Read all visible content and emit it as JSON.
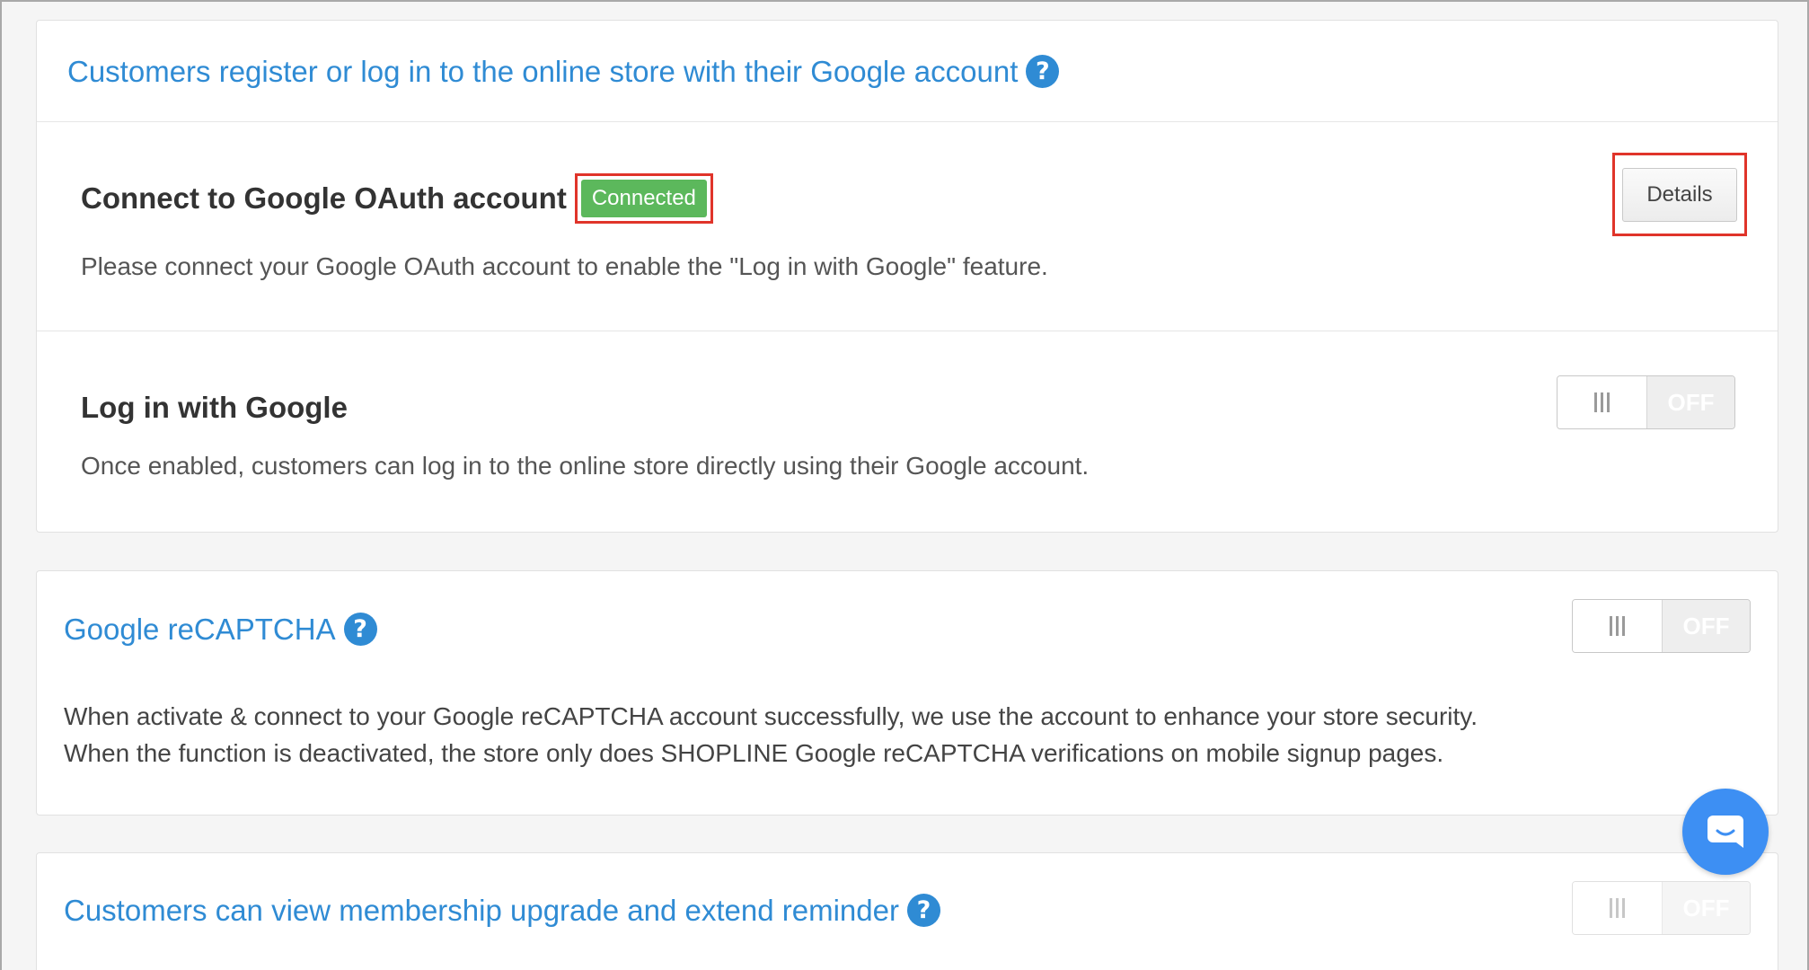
{
  "google_account_card": {
    "title": "Customers register or log in to the online store with their Google account",
    "help_icon": "question-circle-icon",
    "oauth": {
      "heading": "Connect to Google OAuth account",
      "status_badge": "Connected",
      "description": "Please connect your Google OAuth account to enable the \"Log in with Google\" feature.",
      "details_button": "Details"
    },
    "login_with_google": {
      "heading": "Log in with Google",
      "description": "Once enabled, customers can log in to the online store directly using their Google account.",
      "toggle_state": "OFF"
    }
  },
  "recaptcha_card": {
    "title": "Google reCAPTCHA",
    "help_icon": "question-circle-icon",
    "toggle_state": "OFF",
    "description_line1": "When activate & connect to your Google reCAPTCHA account successfully, we use the account to enhance your store security.",
    "description_line2": "When the function is deactivated, the store only does SHOPLINE Google reCAPTCHA verifications on mobile signup pages."
  },
  "membership_card": {
    "title": "Customers can view membership upgrade and extend reminder",
    "help_icon": "question-circle-icon",
    "toggle_state": "OFF"
  },
  "chat_widget": {
    "icon": "chat-bubble-icon"
  },
  "colors": {
    "link": "#2f8bd4",
    "badge_success": "#5cb85c",
    "highlight_outline": "#e0342a",
    "chat_button": "#3d8ff3"
  }
}
